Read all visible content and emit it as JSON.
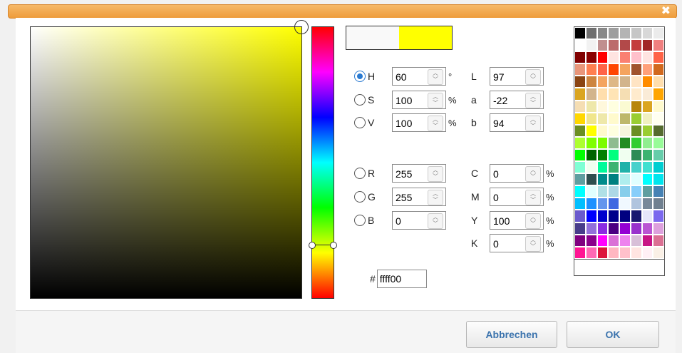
{
  "dialog": {
    "close_glyph": "✖"
  },
  "color": {
    "hue_color": "#ffff00",
    "preview_previous": "#f9f9f9",
    "preview_current": "#ffff00"
  },
  "hsv": {
    "h": {
      "label": "H",
      "value": "60",
      "unit": "°",
      "selected": true
    },
    "s": {
      "label": "S",
      "value": "100",
      "unit": "%"
    },
    "v": {
      "label": "V",
      "value": "100",
      "unit": "%"
    }
  },
  "lab": {
    "l": {
      "label": "L",
      "value": "97"
    },
    "a": {
      "label": "a",
      "value": "-22"
    },
    "b": {
      "label": "b",
      "value": "94"
    }
  },
  "rgb": {
    "r": {
      "label": "R",
      "value": "255"
    },
    "g": {
      "label": "G",
      "value": "255"
    },
    "b": {
      "label": "B",
      "value": "0"
    }
  },
  "cmyk": {
    "c": {
      "label": "C",
      "value": "0",
      "unit": "%"
    },
    "m": {
      "label": "M",
      "value": "0",
      "unit": "%"
    },
    "y": {
      "label": "Y",
      "value": "100",
      "unit": "%"
    },
    "k": {
      "label": "K",
      "value": "0",
      "unit": "%"
    }
  },
  "hex": {
    "prefix": "#",
    "value": "ffff00"
  },
  "palette": [
    "#000000",
    "#6f6f6f",
    "#888888",
    "#9e9e9e",
    "#b4b4b4",
    "#c6c6c6",
    "#d8d8d8",
    "#ebebeb",
    "#ffffff",
    "#f2f2f2",
    "#c08f8f",
    "#bc6b6b",
    "#b24949",
    "#c43d3d",
    "#a12626",
    "#f07f7f",
    "#800000",
    "#8b0000",
    "#ff0000",
    "#ffe4e1",
    "#fa8072",
    "#ffc0cb",
    "#ffe4e1",
    "#ff6347",
    "#e9967a",
    "#ff7f50",
    "#ff6347",
    "#ff4500",
    "#f4a460",
    "#a0522d",
    "#ffa07a",
    "#d2691e",
    "#8b4513",
    "#cd853f",
    "#f4a460",
    "#deb887",
    "#d2b48c",
    "#ffe4c4",
    "#ff8c00",
    "#ffdead",
    "#daa520",
    "#d2b48c",
    "#ffdead",
    "#ffe4b5",
    "#f5deb3",
    "#ffebcd",
    "#faebd7",
    "#ffa500",
    "#f5deb3",
    "#eee8aa",
    "#fff8dc",
    "#ffffe0",
    "#fafad2",
    "#b8860b",
    "#daa520",
    "#fffacd",
    "#ffd700",
    "#f0e68c",
    "#eee8aa",
    "#fffacd",
    "#bdb76b",
    "#9acd32",
    "#f0f0c0",
    "#fffff0",
    "#6b8e23",
    "#ffff00",
    "#fffacd",
    "#ffffe0",
    "#f5f5dc",
    "#6b8e23",
    "#9acd32",
    "#556b2f",
    "#adff2f",
    "#7fff00",
    "#7cfc00",
    "#8fbc8f",
    "#228b22",
    "#32cd32",
    "#90ee90",
    "#98fb98",
    "#00ff00",
    "#006400",
    "#008000",
    "#00ff7f",
    "#f0fff0",
    "#2e8b57",
    "#3cb371",
    "#66cdaa",
    "#7fffd4",
    "#f0fff0",
    "#00fa9a",
    "#3cb371",
    "#20b2aa",
    "#48d1cc",
    "#40e0d0",
    "#00ced1",
    "#5f9ea0",
    "#2f4f4f",
    "#008b8b",
    "#008080",
    "#afeeee",
    "#e0ffff",
    "#00ffff",
    "#00e5ee",
    "#00ffff",
    "#e0ffff",
    "#b0e0e6",
    "#add8e6",
    "#87ceeb",
    "#87cefa",
    "#5f9ea0",
    "#4682b4",
    "#00bfff",
    "#1e90ff",
    "#6495ed",
    "#4169e1",
    "#f0f8ff",
    "#b0c4de",
    "#778899",
    "#708090",
    "#6a5acd",
    "#0000ff",
    "#0000cd",
    "#00008b",
    "#000080",
    "#191970",
    "#e6e6fa",
    "#7b68ee",
    "#483d8b",
    "#9370db",
    "#8a2be2",
    "#4b0082",
    "#9400d3",
    "#9932cc",
    "#ba55d3",
    "#dda0dd",
    "#800080",
    "#8b008b",
    "#ff00ff",
    "#da70d6",
    "#ee82ee",
    "#d8bfd8",
    "#c71585",
    "#db7093",
    "#ff1493",
    "#ff69b4",
    "#dc143c",
    "#ffb6c1",
    "#ffc0cb",
    "#ffe4e1",
    "#fff0f5",
    "#faf0e6"
  ],
  "buttons": {
    "cancel": "Abbrechen",
    "ok": "OK"
  }
}
